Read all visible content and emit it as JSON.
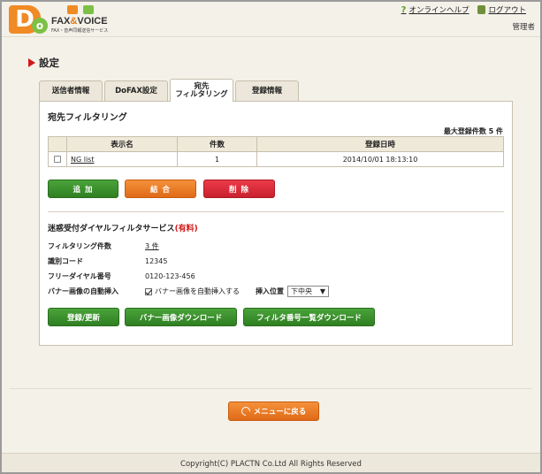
{
  "header": {
    "logo_text": "FAX&VOICE",
    "logo_fax": "FAX",
    "logo_amp": "&",
    "logo_voice": "VOICE",
    "logo_sub": "FAX・音声同報送信サービス",
    "help_link": "オンラインヘルプ",
    "logout_link": "ログアウト",
    "user_name": "管理者"
  },
  "page": {
    "title": "設定"
  },
  "tabs": [
    {
      "label": "送信者情報",
      "active": false
    },
    {
      "label": "DoFAX設定",
      "active": false
    },
    {
      "label_line1": "宛先",
      "label_line2": "フィルタリング",
      "active": true
    },
    {
      "label": "登録情報",
      "active": false
    }
  ],
  "filter": {
    "section_title": "宛先フィルタリング",
    "max_label": "最大登録件数 5 件",
    "columns": {
      "name": "表示名",
      "count": "件数",
      "date": "登録日時"
    },
    "rows": [
      {
        "name": "NG list",
        "count": "1",
        "date": "2014/10/01 18:13:10"
      }
    ],
    "add_button": "追 加",
    "merge_button": "結 合",
    "delete_button": "削 除"
  },
  "service": {
    "title": "迷惑受付ダイヤルフィルタサービス",
    "paid": "(有料)",
    "rows": {
      "count_label": "フィルタリング件数",
      "count_value": "3 件",
      "id_label": "識別コード",
      "id_value": "12345",
      "dial_label": "フリーダイヤル番号",
      "dial_value": "0120-123-456",
      "banner_label": "バナー画像の自動挿入",
      "banner_check": "バナー画像を自動挿入する",
      "banner_checked": true,
      "position_label": "挿入位置",
      "position_value": "下中央"
    },
    "register_button": "登録/更新",
    "banner_download_button": "バナー画像ダウンロード",
    "filter_download_button": "フィルタ番号一覧ダウンロード"
  },
  "back_button": "メニューに戻る",
  "footer": {
    "copyright": "Copyright(C) PLACTN Co.Ltd All Rights Reserved"
  },
  "colors": {
    "accent_orange": "#e06a17",
    "green": "#2f7f22",
    "red": "#c9202e",
    "title_marker": "#d21818"
  }
}
